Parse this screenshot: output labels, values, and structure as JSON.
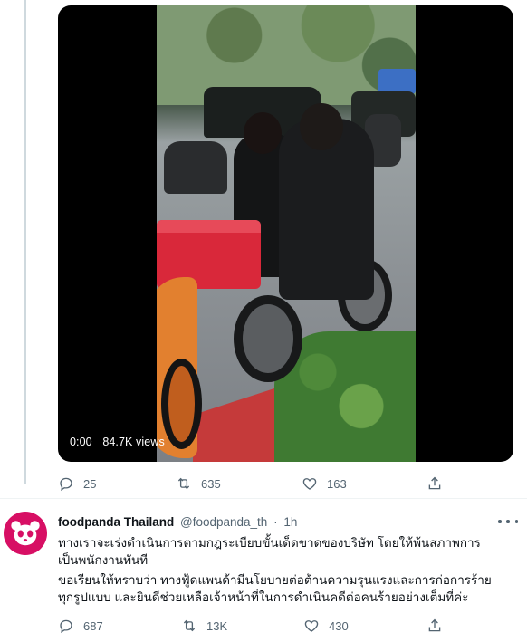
{
  "video": {
    "timestamp": "0:00",
    "views": "84.7K views"
  },
  "first_tweet_actions": {
    "replies": "25",
    "retweets": "635",
    "likes": "163"
  },
  "reply_tweet": {
    "display_name": "foodpanda Thailand",
    "handle": "@foodpanda_th",
    "separator": "·",
    "time": "1h",
    "lines": [
      "ทางเราจะเร่งดำเนินการตามกฎระเบียบขั้นเด็ดขาดของบริษัท โดยให้พ้นสภาพการ",
      "เป็นพนักงานทันที",
      "ขอเรียนให้ทราบว่า ทางฟู้ดแพนด้ามีนโยบายต่อต้านความรุนแรงและการก่อการร้าย",
      "ทุกรูปแบบ และยินดีช่วยเหลือเจ้าหน้าที่ในการดำเนินคดีต่อคนร้ายอย่างเต็มที่ค่ะ"
    ],
    "actions": {
      "replies": "687",
      "retweets": "13K",
      "likes": "430"
    }
  },
  "colors": {
    "brand_pink": "#d70f64",
    "icon_gray": "#536471",
    "thread_line": "#cfd9de"
  },
  "icons": {
    "reply": "reply-icon",
    "retweet": "retweet-icon",
    "like": "heart-icon",
    "share": "share-icon",
    "more": "more-icon"
  }
}
